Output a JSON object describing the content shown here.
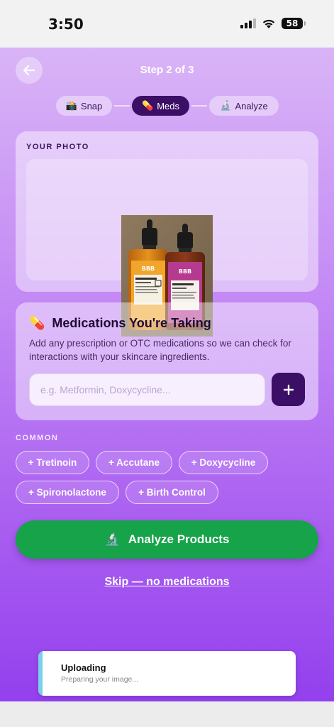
{
  "status_bar": {
    "time": "3:50",
    "battery": "58"
  },
  "header": {
    "title": "Step 2 of 3",
    "back_icon": "arrow-left-icon"
  },
  "stepper": [
    {
      "icon": "📸",
      "label": "Snap",
      "active": false
    },
    {
      "icon": "💊",
      "label": "Meds",
      "active": true
    },
    {
      "icon": "🔬",
      "label": "Analyze",
      "active": false
    }
  ],
  "photo_card": {
    "label": "YOUR PHOTO",
    "bottles": [
      {
        "brand": "BBB",
        "label": "VITAMIN C",
        "sublabel": "SERUM",
        "color": "#e9a32a"
      },
      {
        "brand": "BBB",
        "label": "RETINOL",
        "sublabel": "SERUM",
        "color": "#b53a8e"
      }
    ]
  },
  "meds_card": {
    "icon": "💊",
    "title": "Medications You're Taking",
    "description": "Add any prescription or OTC medications so we can check for interactions with your skincare ingredients.",
    "input_value": "",
    "input_placeholder": "e.g. Metformin, Doxycycline...",
    "add_label": "+"
  },
  "common": {
    "label": "COMMON",
    "chips": [
      "+ Tretinoin",
      "+ Accutane",
      "+ Doxycycline",
      "+ Spironolactone",
      "+ Birth Control"
    ]
  },
  "analyze_button": {
    "icon": "🔬",
    "label": "Analyze Products"
  },
  "skip_link": "Skip — no medications",
  "toast": {
    "title": "Uploading",
    "subtitle": "Preparing your image..."
  },
  "colors": {
    "primary_dark": "#3b0f66",
    "cta_green": "#16a349",
    "toast_accent": "#7ccfe8"
  }
}
